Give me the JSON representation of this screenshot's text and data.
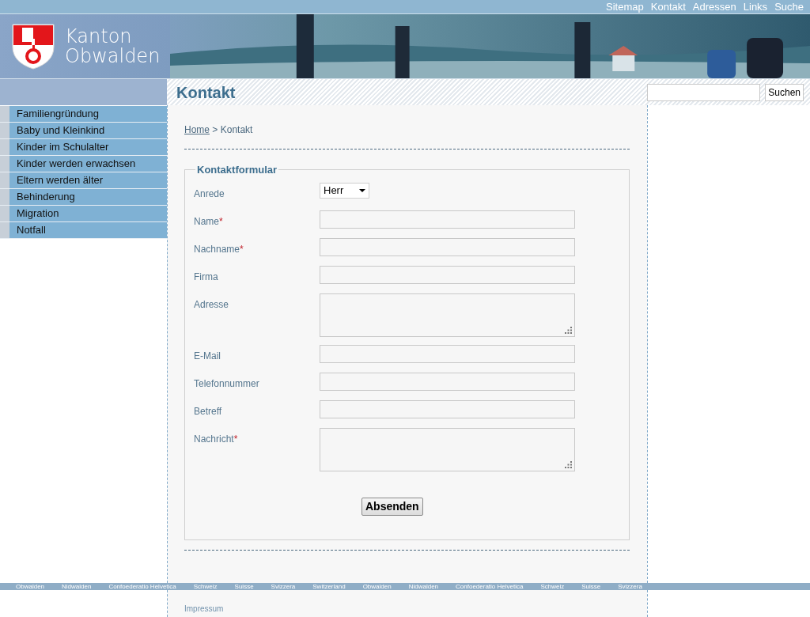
{
  "top_links": [
    "Sitemap",
    "Kontakt",
    "Adressen",
    "Links",
    "Suche"
  ],
  "logo": {
    "line1": "Kanton",
    "line2": "Obwalden"
  },
  "page_title": "Kontakt",
  "search": {
    "button": "Suchen"
  },
  "sidebar": {
    "items": [
      {
        "label": "Familiengründung",
        "selected": false
      },
      {
        "label": "Baby und Kleinkind",
        "selected": false
      },
      {
        "label": "Kinder im Schulalter",
        "selected": false
      },
      {
        "label": "Kinder werden erwachsen",
        "selected": false
      },
      {
        "label": "Eltern werden älter",
        "selected": false
      },
      {
        "label": "Behinderung",
        "selected": false
      },
      {
        "label": "Migration",
        "selected": false
      },
      {
        "label": "Notfall",
        "selected": false
      }
    ]
  },
  "breadcrumb": {
    "link": "Home",
    "separator": ">",
    "current": "Kontakt"
  },
  "form": {
    "legend": "Kontaktformular",
    "fields": [
      {
        "label": "Anrede",
        "kind": "select",
        "required": false,
        "value": "Herr"
      },
      {
        "label": "Name",
        "kind": "input",
        "required": true
      },
      {
        "label": "Nachname",
        "kind": "input",
        "required": true
      },
      {
        "label": "Firma",
        "kind": "input",
        "required": false
      },
      {
        "label": "Adresse",
        "kind": "textarea",
        "required": false
      },
      {
        "label": "E-Mail",
        "kind": "input",
        "required": false
      },
      {
        "label": "Telefonnummer",
        "kind": "input",
        "required": false
      },
      {
        "label": "Betreff",
        "kind": "input",
        "required": false
      },
      {
        "label": "Nachricht",
        "kind": "textarea",
        "required": true
      }
    ],
    "required_mark": "*",
    "submit": "Absenden"
  },
  "footer_strip": [
    "Obwalden",
    "Nidwalden",
    "Confoederatio Helvetica",
    "Schweiz",
    "Suisse",
    "Svizzera",
    "Switzerland",
    "Obwalden",
    "Nidwalden",
    "Confoederatio Helvetica",
    "Schweiz",
    "Suisse",
    "Svizzera"
  ],
  "footer": {
    "link": "Impressum"
  }
}
